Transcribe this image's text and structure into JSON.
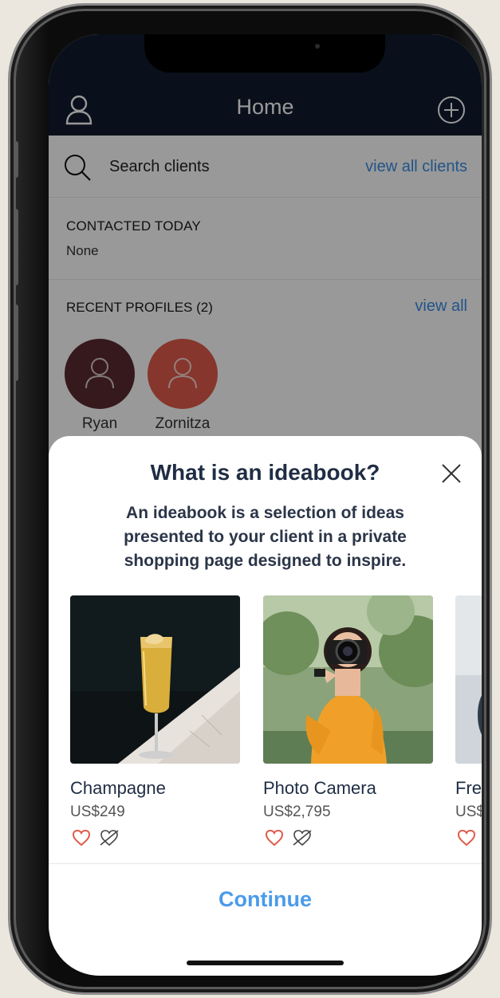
{
  "header": {
    "title": "Home"
  },
  "search": {
    "label": "Search clients",
    "view_all": "view all clients"
  },
  "contacted": {
    "heading": "CONTACTED TODAY",
    "value": "None"
  },
  "recent": {
    "heading": "RECENT PROFILES (2)",
    "view_all": "view all",
    "profiles": [
      {
        "name": "Ryan",
        "color": "#5b2b31"
      },
      {
        "name": "Zornitza",
        "color": "#e05a4a"
      }
    ]
  },
  "modal": {
    "title": "What is an ideabook?",
    "description": "An ideabook is a selection of ideas presented to your client in a private shopping page designed to inspire.",
    "cards": [
      {
        "name": "Champagne",
        "price": "US$249"
      },
      {
        "name": "Photo Camera",
        "price": "US$2,795"
      },
      {
        "name": "Fre",
        "price": "US$"
      }
    ],
    "continue": "Continue"
  },
  "colors": {
    "navy": "#0f1b2e",
    "link": "#3a8de5",
    "heart": "#e05a4a",
    "continue": "#4b9bea"
  }
}
